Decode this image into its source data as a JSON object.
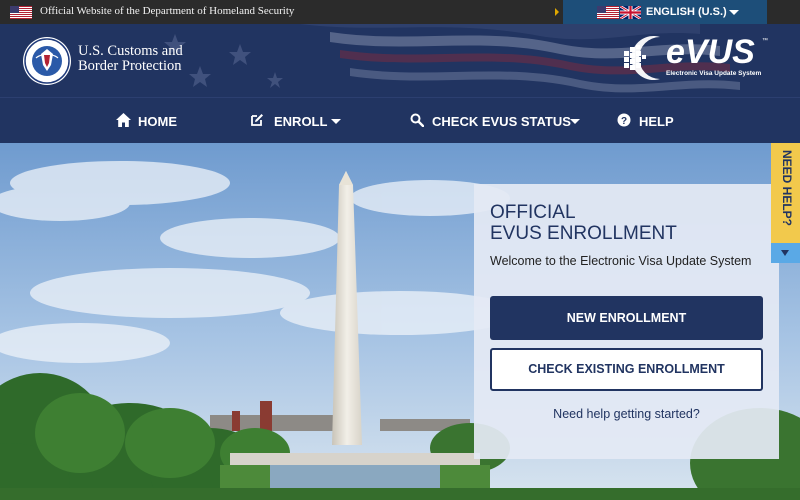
{
  "gov_banner": {
    "text": "Official Website of the Department of Homeland Security"
  },
  "language": {
    "label": "ENGLISH (U.S.)"
  },
  "header": {
    "agency_line1": "U.S. Customs and",
    "agency_line2": "Border Protection",
    "logo_text": "eVUS",
    "logo_tm": "™",
    "logo_tagline": "Electronic Visa Update System"
  },
  "nav": {
    "items": [
      {
        "label": "HOME",
        "icon": "home-icon",
        "has_dropdown": false
      },
      {
        "label": "ENROLL",
        "icon": "edit-icon",
        "has_dropdown": true
      },
      {
        "label": "CHECK EVUS STATUS",
        "icon": "search-icon",
        "has_dropdown": true
      },
      {
        "label": "HELP",
        "icon": "question-icon",
        "has_dropdown": false
      }
    ]
  },
  "card": {
    "title_line1": "OFFICIAL",
    "title_line2": "EVUS ENROLLMENT",
    "welcome": "Welcome to the Electronic Visa Update System",
    "new_enrollment_label": "NEW ENROLLMENT",
    "check_enrollment_label": "CHECK EXISTING ENROLLMENT",
    "help_link": "Need help getting started?"
  },
  "help_tab": {
    "label": "NEED HELP?"
  },
  "colors": {
    "navy": "#213461",
    "banner": "#2b2b2b",
    "language_bg": "#1d4e79",
    "help_tab": "#f2c94c",
    "help_arrow": "#5aa9e6"
  }
}
